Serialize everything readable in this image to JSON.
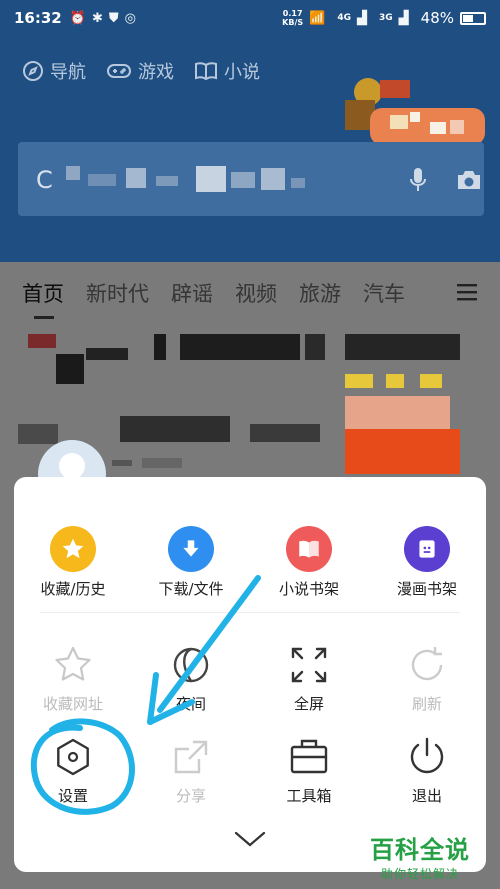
{
  "status_bar": {
    "time": "16:32",
    "net_speed_value": "0.17",
    "net_speed_unit": "KB/S",
    "signal_1": "4G",
    "signal_2": "3G",
    "battery": "48%"
  },
  "header": {
    "quick_links": [
      {
        "label": "导航",
        "icon": "compass-icon"
      },
      {
        "label": "游戏",
        "icon": "gamepad-icon"
      },
      {
        "label": "小说",
        "icon": "book-icon"
      }
    ],
    "search_visible_char": "C"
  },
  "tabs": [
    "首页",
    "新时代",
    "辟谣",
    "视频",
    "旅游",
    "汽车"
  ],
  "menu": {
    "row1": [
      {
        "label": "收藏/历史",
        "icon": "star-icon",
        "color": "#f6b81a"
      },
      {
        "label": "下载/文件",
        "icon": "download-icon",
        "color": "#2f8ff0"
      },
      {
        "label": "小说书架",
        "icon": "novel-book-icon",
        "color": "#ef5a5a"
      },
      {
        "label": "漫画书架",
        "icon": "comic-icon",
        "color": "#5b3fd1"
      }
    ],
    "row2": [
      {
        "label": "收藏网址",
        "icon": "star-outline-icon",
        "enabled": false
      },
      {
        "label": "夜间",
        "icon": "moon-icon",
        "enabled": true
      },
      {
        "label": "全屏",
        "icon": "fullscreen-icon",
        "enabled": true
      },
      {
        "label": "刷新",
        "icon": "refresh-icon",
        "enabled": false
      }
    ],
    "row3": [
      {
        "label": "设置",
        "icon": "settings-hexagon-icon",
        "enabled": true
      },
      {
        "label": "分享",
        "icon": "share-icon",
        "enabled": false
      },
      {
        "label": "工具箱",
        "icon": "toolbox-icon",
        "enabled": true
      },
      {
        "label": "退出",
        "icon": "power-icon",
        "enabled": true
      }
    ]
  },
  "annotation_color": "#21b3e8",
  "watermark": {
    "title": "百科全说",
    "subtitle": "助你轻松解决",
    "color": "#26a045"
  }
}
